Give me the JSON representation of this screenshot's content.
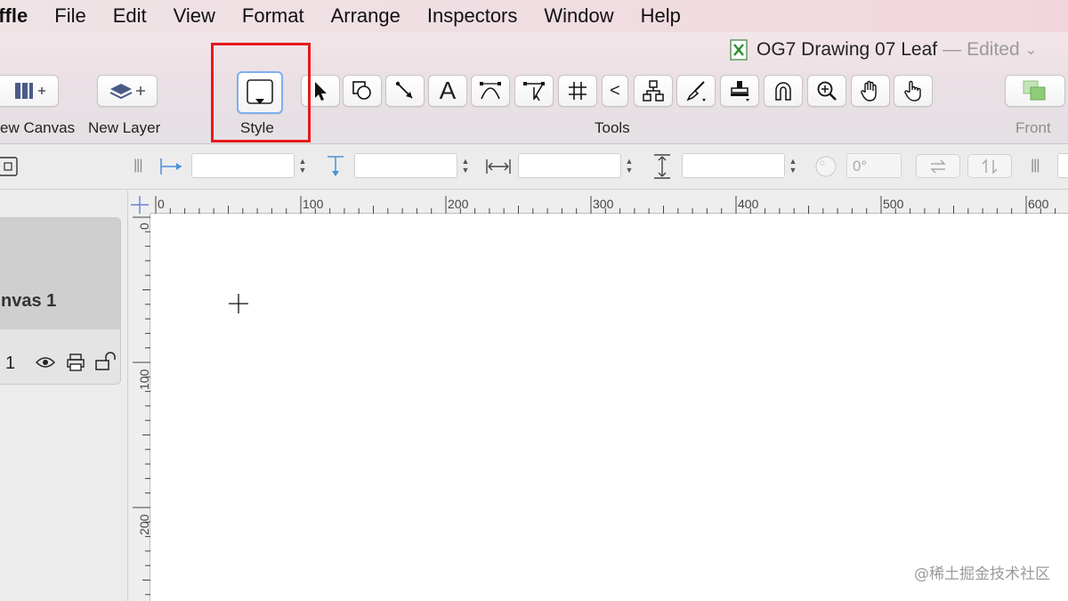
{
  "menubar": {
    "app": "affle",
    "items": [
      "File",
      "Edit",
      "View",
      "Format",
      "Arrange",
      "Inspectors",
      "Window",
      "Help"
    ]
  },
  "window": {
    "title": "OG7 Drawing 07 Leaf",
    "separator": "—",
    "status": "Edited"
  },
  "toolbar": {
    "new_canvas_label": "ew Canvas",
    "new_layer_label": "New Layer",
    "style_label": "Style",
    "tools_label": "Tools",
    "front_label": "Front",
    "tools": [
      {
        "name": "selection-arrow"
      },
      {
        "name": "shape"
      },
      {
        "name": "line"
      },
      {
        "name": "text",
        "glyph": "A"
      },
      {
        "name": "bezier-pen"
      },
      {
        "name": "point-editor"
      },
      {
        "name": "diagram-grid"
      },
      {
        "name": "collapse",
        "glyph": "<"
      },
      {
        "name": "diagram-tree"
      },
      {
        "name": "style-brush"
      },
      {
        "name": "rubber-stamp"
      },
      {
        "name": "magnet"
      },
      {
        "name": "zoom"
      },
      {
        "name": "hand"
      },
      {
        "name": "browse-hand"
      }
    ]
  },
  "inspector_bar": {
    "rotation": "0°"
  },
  "sidebar": {
    "canvas_name": "nvas 1",
    "layer_number": "1"
  },
  "rulers": {
    "top": [
      "0",
      "100",
      "200",
      "300",
      "400",
      "500",
      "600"
    ],
    "left": [
      "0",
      "100",
      "200"
    ]
  },
  "watermark": "@稀土掘金技术社区",
  "colors": {
    "highlight": "#e8191b",
    "accent_blue": "#4a90d9"
  }
}
